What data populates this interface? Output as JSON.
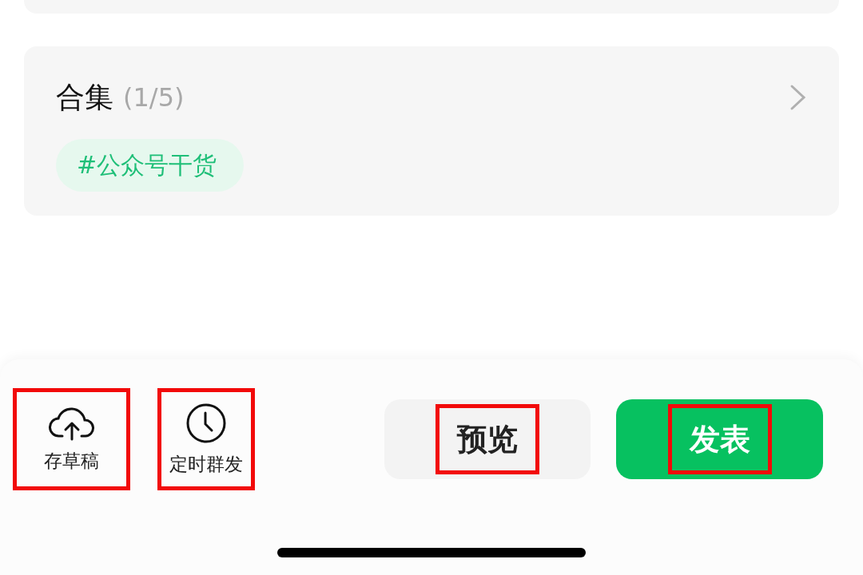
{
  "collection": {
    "title": "合集",
    "count": "(1/5)",
    "tags": [
      {
        "label": "#公众号干货"
      }
    ]
  },
  "toolbar": {
    "tools": [
      {
        "kind": "draft",
        "label": "存草稿",
        "highlighted": true
      },
      {
        "kind": "schedule",
        "label": "定时群发",
        "highlighted": true
      }
    ],
    "buttons": [
      {
        "kind": "secondary",
        "label": "预览",
        "highlighted": true
      },
      {
        "kind": "primary",
        "label": "发表",
        "highlighted": true
      }
    ]
  }
}
